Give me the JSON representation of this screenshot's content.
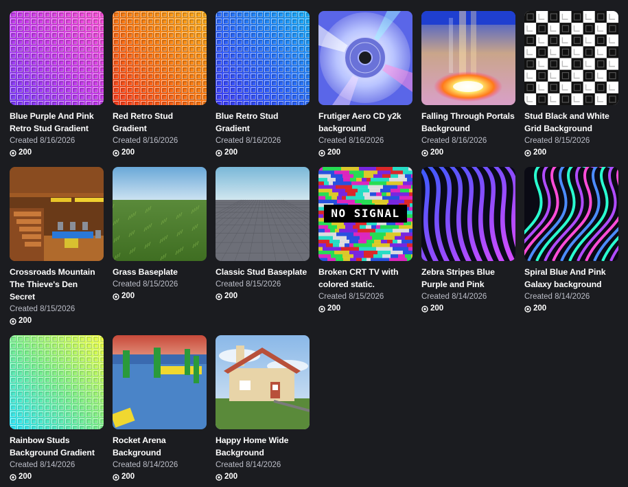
{
  "items": [
    {
      "title": "Blue Purple And Pink Retro Stud Gradient",
      "created": "Created 8/16/2026",
      "price": "200",
      "thumb": "stud-gradient",
      "colors": [
        "#7a3cff",
        "#c93cf0",
        "#ff4fd8"
      ]
    },
    {
      "title": "Red Retro Stud Gradient",
      "created": "Created 8/16/2026",
      "price": "200",
      "thumb": "stud-gradient",
      "colors": [
        "#ff3c1e",
        "#ff7a12",
        "#ffae1a"
      ]
    },
    {
      "title": "Blue Retro Stud Gradient",
      "created": "Created 8/16/2026",
      "price": "200",
      "thumb": "stud-gradient",
      "colors": [
        "#3f3cff",
        "#2a6cff",
        "#18b4ff"
      ]
    },
    {
      "title": "Frutiger Aero CD y2k background",
      "created": "Created 8/16/2026",
      "price": "200",
      "thumb": "cd"
    },
    {
      "title": "Falling Through Portals Background",
      "created": "Created 8/16/2026",
      "price": "200",
      "thumb": "portal"
    },
    {
      "title": "Stud Black and White Grid Background",
      "created": "Created 8/15/2026",
      "price": "200",
      "thumb": "checker"
    },
    {
      "title": "Crossroads Mountain The Thieve's Den Secret",
      "created": "Created 8/15/2026",
      "price": "200",
      "thumb": "den"
    },
    {
      "title": "Grass Baseplate",
      "created": "Created 8/15/2026",
      "price": "200",
      "thumb": "grass"
    },
    {
      "title": "Classic Stud Baseplate",
      "created": "Created 8/15/2026",
      "price": "200",
      "thumb": "baseplate"
    },
    {
      "title": "Broken CRT TV with colored static.",
      "created": "Created 8/15/2026",
      "price": "200",
      "thumb": "nosignal",
      "overlay_text": "NO SIGNAL"
    },
    {
      "title": "Zebra Stripes Blue Purple and Pink",
      "created": "Created 8/14/2026",
      "price": "200",
      "thumb": "zebra"
    },
    {
      "title": "Spiral Blue And Pink Galaxy background",
      "created": "Created 8/14/2026",
      "price": "200",
      "thumb": "spiral"
    },
    {
      "title": "Rainbow Studs Background Gradient",
      "created": "Created 8/14/2026",
      "price": "200",
      "thumb": "rainbow"
    },
    {
      "title": "Rocket Arena Background",
      "created": "Created 8/14/2026",
      "price": "200",
      "thumb": "arena"
    },
    {
      "title": "Happy Home Wide Background",
      "created": "Created 8/14/2026",
      "price": "200",
      "thumb": "house"
    }
  ]
}
